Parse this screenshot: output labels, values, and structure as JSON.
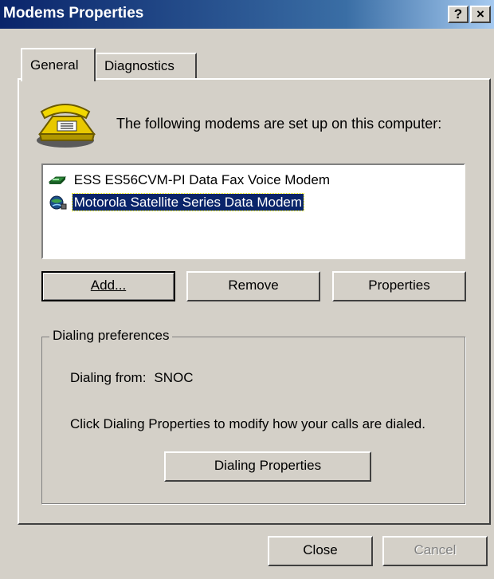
{
  "window": {
    "title": "Modems Properties",
    "help_glyph": "?",
    "close_glyph": "×"
  },
  "tabs": [
    {
      "label": "General",
      "active": true
    },
    {
      "label": "Diagnostics",
      "active": false
    }
  ],
  "general": {
    "intro_text": "The following modems are set up on this computer:",
    "icon": "telephone-modem-icon",
    "modems": [
      {
        "name": "ESS ES56CVM-PI Data Fax Voice Modem",
        "icon": "modem-device-icon",
        "selected": false
      },
      {
        "name": "Motorola Satellite Series Data Modem",
        "icon": "satellite-modem-icon",
        "selected": true
      }
    ],
    "buttons": {
      "add": "Add...",
      "remove": "Remove",
      "properties": "Properties"
    },
    "dialing": {
      "group_label": "Dialing preferences",
      "from_label": "Dialing from:",
      "from_value": "SNOC",
      "hint": "Click Dialing Properties to modify how your calls are dialed.",
      "button": "Dialing Properties"
    }
  },
  "footer": {
    "close": "Close",
    "cancel": "Cancel"
  },
  "colors": {
    "face": "#d4d0c8",
    "title_start": "#0a246a",
    "title_end": "#a6caf0",
    "selection": "#0a246a"
  }
}
